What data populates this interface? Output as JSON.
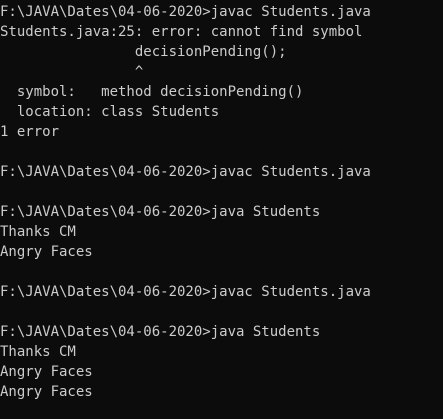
{
  "terminal": {
    "background": "#0c0c0c",
    "foreground": "#cccccc",
    "lines": [
      "F:\\JAVA\\Dates\\04-06-2020>javac Students.java",
      "Students.java:25: error: cannot find symbol",
      "                decisionPending();",
      "                ^",
      "  symbol:   method decisionPending()",
      "  location: class Students",
      "1 error",
      "",
      "F:\\JAVA\\Dates\\04-06-2020>javac Students.java",
      "",
      "F:\\JAVA\\Dates\\04-06-2020>java Students",
      "Thanks CM",
      "Angry Faces",
      "",
      "F:\\JAVA\\Dates\\04-06-2020>javac Students.java",
      "",
      "F:\\JAVA\\Dates\\04-06-2020>java Students",
      "Thanks CM",
      "Angry Faces",
      "Angry Faces"
    ]
  }
}
